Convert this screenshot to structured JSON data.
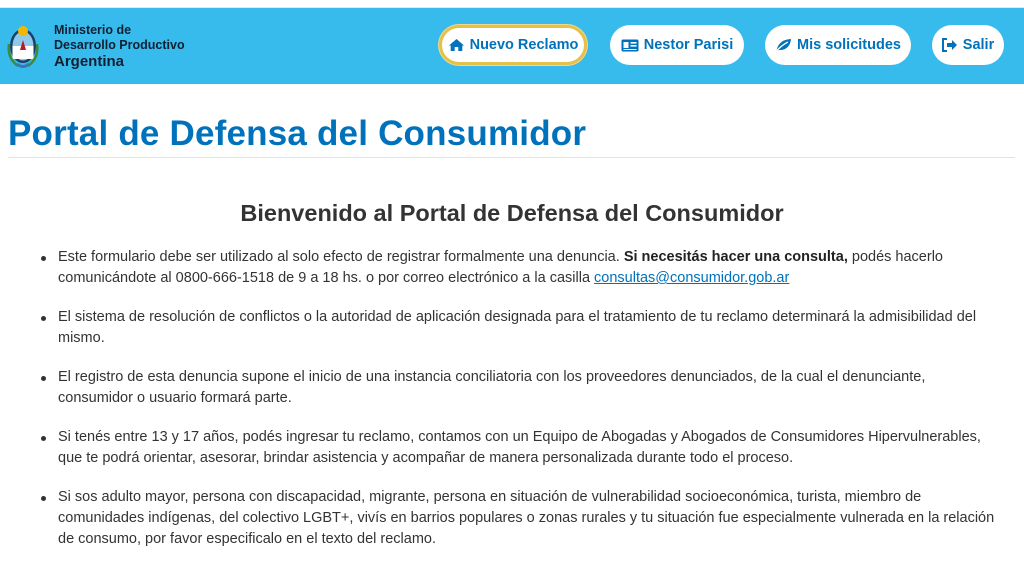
{
  "brand": {
    "line1": "Ministerio de",
    "line2": "Desarrollo Productivo",
    "line3": "Argentina",
    "icon": "argentina-coat-of-arms-icon"
  },
  "nav": {
    "nuevo_reclamo": {
      "label": "Nuevo Reclamo",
      "icon": "home-icon"
    },
    "user": {
      "label": "Nestor Parisi",
      "icon": "id-card-icon"
    },
    "solicitudes": {
      "label": "Mis solicitudes",
      "icon": "leaf-icon"
    },
    "salir": {
      "label": "Salir",
      "icon": "sign-out-icon"
    }
  },
  "page": {
    "title": "Portal de Defensa del Consumidor",
    "subtitle": "Bienvenido al Portal de Defensa del Consumidor"
  },
  "bullets": {
    "b1": {
      "text_a": "Este formulario debe ser utilizado al solo efecto de registrar formalmente una denuncia. ",
      "strong": "Si necesitás hacer una consulta,",
      "text_b": " podés hacerlo comunicándote al 0800-666-1518 de 9 a 18 hs. o por correo electrónico a la casilla ",
      "link": "consultas@consumidor.gob.ar"
    },
    "b2": "El sistema de resolución de conflictos o la autoridad de aplicación designada para el tratamiento de tu reclamo determinará la admisibilidad del mismo.",
    "b3": "El registro de esta denuncia supone el inicio de una instancia conciliatoria con los proveedores denunciados, de la cual el denunciante, consumidor o usuario formará parte.",
    "b4": "Si tenés entre 13 y 17 años, podés ingresar tu reclamo, contamos con un Equipo de Abogadas y Abogados de Consumidores Hipervulnerables, que te podrá orientar, asesorar, brindar asistencia y acompañar de manera personalizada durante todo el proceso.",
    "b5": "Si sos adulto mayor, persona con discapacidad, migrante, persona en situación de vulnerabilidad socioeconómica, turista, miembro de comunidades indígenas, del colectivo LGBT+, vivís en barrios populares o zonas rurales y tu situación fue especialmente vulnerada en la relación de consumo, por favor especificalo en el texto del reclamo."
  },
  "colors": {
    "navbar": "#37bbed",
    "accent": "#0072bb",
    "active_border": "#e5c04a"
  }
}
